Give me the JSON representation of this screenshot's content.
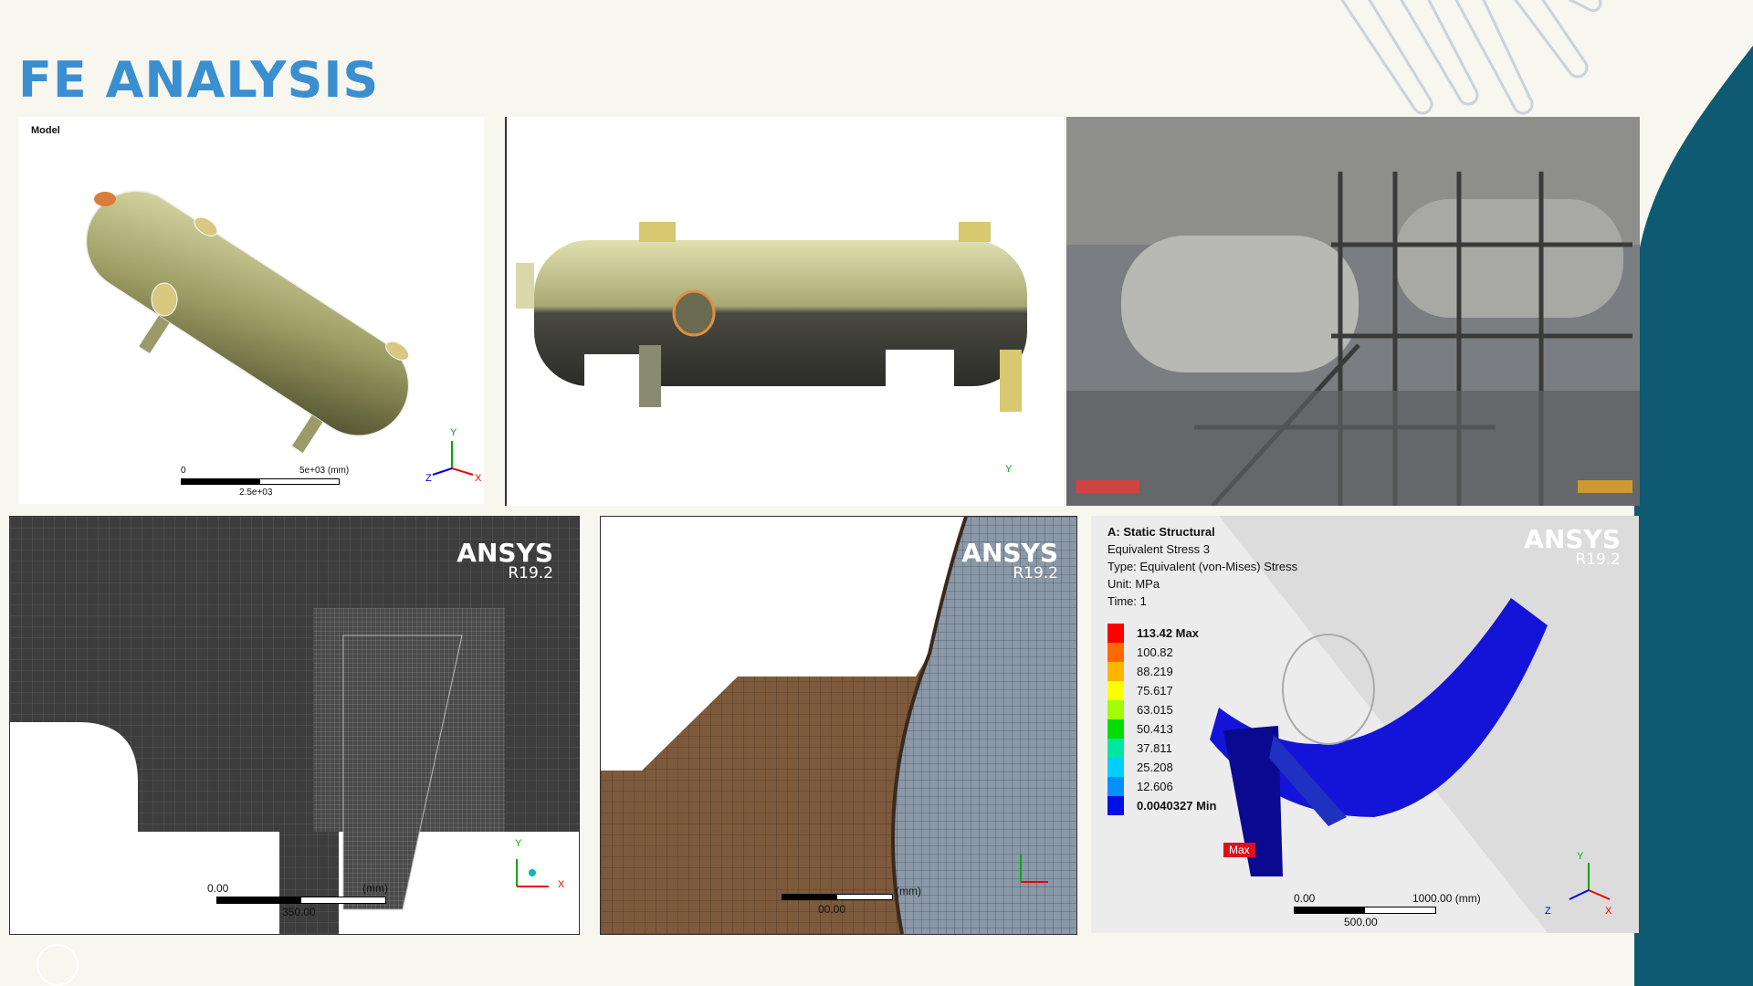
{
  "slide": {
    "title": "FE ANALYSIS"
  },
  "panel1": {
    "label": "Model",
    "scale_start": "0",
    "scale_end": "5e+03 (mm)",
    "scale_mid": "2.5e+03",
    "axis_y": "Y",
    "axis_x": "X",
    "axis_z": "Z"
  },
  "panel2": {
    "axis_y": "Y"
  },
  "panel4": {
    "brand": "ANSYS",
    "version": "R19.2",
    "scale_start": "0.00",
    "scale_end": "(mm)",
    "scale_mid": "350.00",
    "axis_y": "Y",
    "axis_x": "X"
  },
  "panel5": {
    "brand": "ANSYS",
    "version": "R19.2",
    "scale_mid": "00.00",
    "scale_end": "(mm)"
  },
  "panel6": {
    "brand": "ANSYS",
    "version": "R19.2",
    "header": "A: Static Structural",
    "result": "Equivalent Stress 3",
    "type": "Type: Equivalent (von-Mises) Stress",
    "unit": "Unit: MPa",
    "time": "Time: 1",
    "legend": [
      {
        "value": "113.42 Max",
        "color": "#ff0000"
      },
      {
        "value": "100.82",
        "color": "#ff6a00"
      },
      {
        "value": "88.219",
        "color": "#ffb400"
      },
      {
        "value": "75.617",
        "color": "#ffff00"
      },
      {
        "value": "63.015",
        "color": "#a0ff00"
      },
      {
        "value": "50.413",
        "color": "#00e000"
      },
      {
        "value": "37.811",
        "color": "#00e8a0"
      },
      {
        "value": "25.208",
        "color": "#00d0ff"
      },
      {
        "value": "12.606",
        "color": "#0090ff"
      },
      {
        "value": "0.0040327 Min",
        "color": "#0010e0"
      }
    ],
    "max_tag": "Max",
    "scale_start": "0.00",
    "scale_end": "1000.00 (mm)",
    "scale_mid": "500.00",
    "axis_y": "Y",
    "axis_x": "X",
    "axis_z": "Z"
  },
  "colors": {
    "title": "#3a8fd0",
    "teal": "#0d5a72",
    "mesh": "#3c3c3c",
    "brown": "#7d5a3c",
    "vessel": "#b8b87f"
  }
}
